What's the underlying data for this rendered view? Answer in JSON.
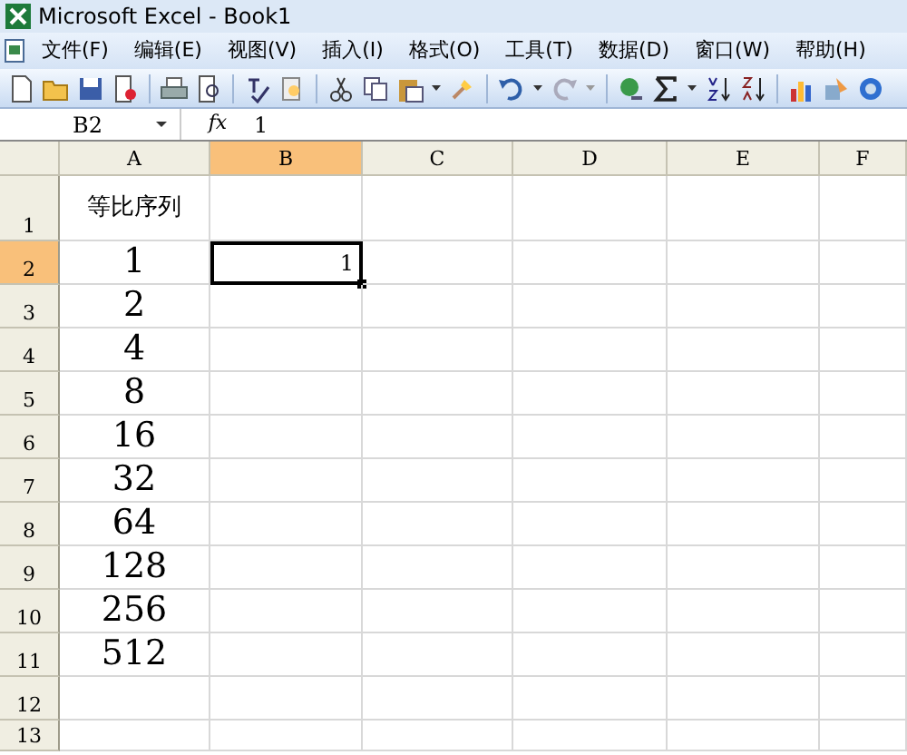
{
  "window": {
    "title": "Microsoft Excel - Book1"
  },
  "menu": [
    "文件(F)",
    "编辑(E)",
    "视图(V)",
    "插入(I)",
    "格式(O)",
    "工具(T)",
    "数据(D)",
    "窗口(W)",
    "帮助(H)"
  ],
  "formula_bar": {
    "name_box": "B2",
    "fx": "fx",
    "value": "1"
  },
  "columns": [
    {
      "label": "A",
      "selected": false
    },
    {
      "label": "B",
      "selected": true
    },
    {
      "label": "C",
      "selected": false
    },
    {
      "label": "D",
      "selected": false
    },
    {
      "label": "E",
      "selected": false
    },
    {
      "label": "F",
      "selected": false
    }
  ],
  "rows": [
    {
      "label": "1",
      "selected": false,
      "cells": [
        {
          "text": "等比序列",
          "kind": "label"
        },
        {
          "text": "",
          "kind": "empty"
        }
      ]
    },
    {
      "label": "2",
      "selected": true,
      "cells": [
        {
          "text": "1",
          "kind": "big"
        },
        {
          "text": "1",
          "kind": "active"
        }
      ]
    },
    {
      "label": "3",
      "selected": false,
      "cells": [
        {
          "text": "2",
          "kind": "big"
        }
      ]
    },
    {
      "label": "4",
      "selected": false,
      "cells": [
        {
          "text": "4",
          "kind": "big"
        }
      ]
    },
    {
      "label": "5",
      "selected": false,
      "cells": [
        {
          "text": "8",
          "kind": "big"
        }
      ]
    },
    {
      "label": "6",
      "selected": false,
      "cells": [
        {
          "text": "16",
          "kind": "big"
        }
      ]
    },
    {
      "label": "7",
      "selected": false,
      "cells": [
        {
          "text": "32",
          "kind": "big"
        }
      ]
    },
    {
      "label": "8",
      "selected": false,
      "cells": [
        {
          "text": "64",
          "kind": "big"
        }
      ]
    },
    {
      "label": "9",
      "selected": false,
      "cells": [
        {
          "text": "128",
          "kind": "big"
        }
      ]
    },
    {
      "label": "10",
      "selected": false,
      "cells": [
        {
          "text": "256",
          "kind": "big"
        }
      ]
    },
    {
      "label": "11",
      "selected": false,
      "cells": [
        {
          "text": "512",
          "kind": "big"
        }
      ]
    },
    {
      "label": "12",
      "selected": false,
      "cells": []
    },
    {
      "label": "13",
      "selected": false,
      "cells": []
    }
  ]
}
